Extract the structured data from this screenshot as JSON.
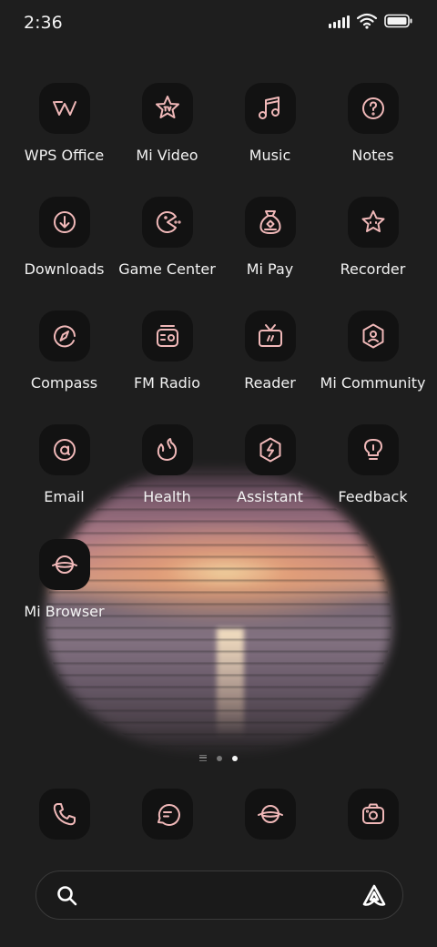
{
  "status_bar": {
    "time": "2:36",
    "icons": [
      "signal-icon",
      "wifi-icon",
      "battery-icon"
    ]
  },
  "apps": [
    {
      "label": "WPS Office",
      "icon": "wps-office-icon"
    },
    {
      "label": "Mi Video",
      "icon": "mi-video-icon"
    },
    {
      "label": "Music",
      "icon": "music-icon"
    },
    {
      "label": "Notes",
      "icon": "notes-icon"
    },
    {
      "label": "Downloads",
      "icon": "downloads-icon"
    },
    {
      "label": "Game Center",
      "icon": "game-center-icon"
    },
    {
      "label": "Mi Pay",
      "icon": "mi-pay-icon"
    },
    {
      "label": "Recorder",
      "icon": "recorder-icon"
    },
    {
      "label": "Compass",
      "icon": "compass-icon"
    },
    {
      "label": "FM Radio",
      "icon": "fm-radio-icon"
    },
    {
      "label": "Reader",
      "icon": "reader-icon"
    },
    {
      "label": "Mi Community",
      "icon": "mi-community-icon"
    },
    {
      "label": "Email",
      "icon": "email-icon"
    },
    {
      "label": "Health",
      "icon": "health-icon"
    },
    {
      "label": "Assistant",
      "icon": "assistant-icon"
    },
    {
      "label": "Feedback",
      "icon": "feedback-icon"
    },
    {
      "label": "Mi Browser",
      "icon": "mi-browser-icon"
    }
  ],
  "page_indicator": {
    "pages": 2,
    "active_page": 2
  },
  "dock": [
    {
      "icon": "phone-icon"
    },
    {
      "icon": "messages-icon"
    },
    {
      "icon": "browser-icon"
    },
    {
      "icon": "camera-icon"
    }
  ],
  "search": {
    "icon": "search-icon",
    "assistant_icon": "assistant-logo-icon"
  },
  "colors": {
    "background": "#1e1e1e",
    "icon_tile": "#121212",
    "icon_accent": "#f0b8b8",
    "label_text": "#f2f2f2"
  }
}
